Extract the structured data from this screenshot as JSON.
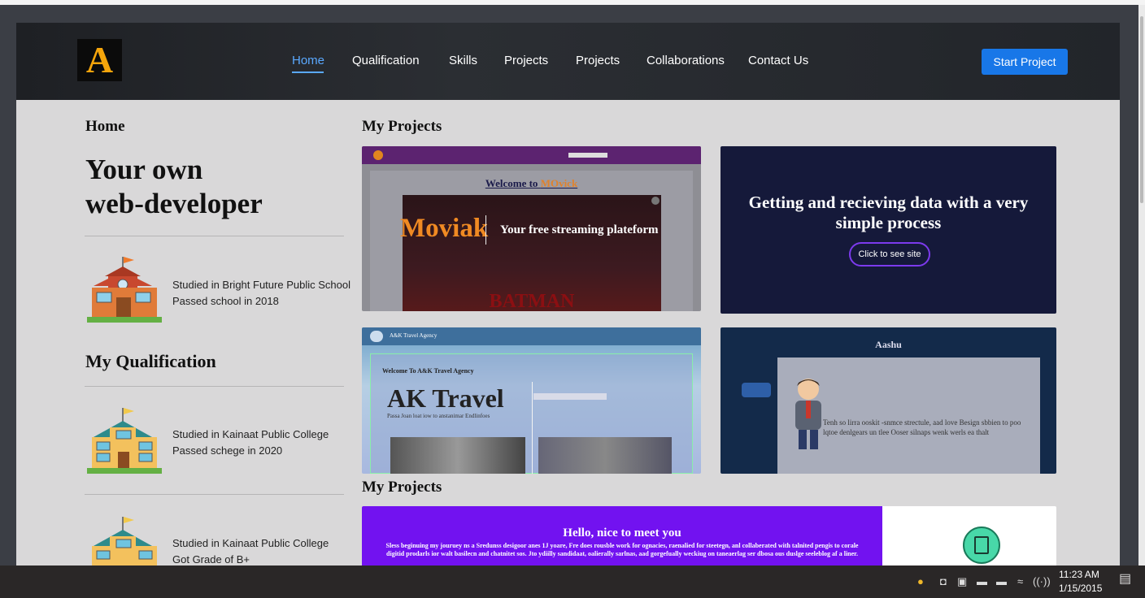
{
  "brand": {
    "logo_letter": "A"
  },
  "nav": {
    "items": [
      "Home",
      "Qualification",
      "Skills",
      "Projects",
      "Projects",
      "Collaborations",
      "Contact Us"
    ],
    "start_button": "Start Project"
  },
  "left": {
    "home_heading": "Home",
    "hero_line1": "Your own",
    "hero_line2": "web-developer",
    "school": {
      "line1": "Studied in Bright Future Public School",
      "line2": "Passed school in 2018"
    },
    "qualification_heading": "My Qualification",
    "college1": {
      "line1": "Studied in Kainaat Public College",
      "line2": "Passed schege in 2020"
    },
    "college2": {
      "line1": "Studied in Kainaat Public College",
      "line2": "Got Grade of B+"
    }
  },
  "projects": {
    "heading_top": "My Projects",
    "heading_bottom": "My Projects",
    "moviak": {
      "welcome_prefix": "Welcome to ",
      "welcome_brand": "MOvick",
      "title": "Moviak",
      "tagline": "Your free streaming plateform",
      "poster_text": "BATMAN"
    },
    "data_card": {
      "title": "Getting and recieving data with a very simple process",
      "button": "Click to see site"
    },
    "travel": {
      "header": "A&K Travel Agency",
      "welcome": "Welcome To A&K Travel Agency",
      "title": "AK Travel",
      "sub": "Passa Joan loat iow to anstanimar Endlinfoes"
    },
    "aashu": {
      "title": "Aashu",
      "body": "Tenh so lirra ooskit -snmce strectule, aad love Besign sbbien to poo lqtoe denlgears un tlee Ooser silnaps wenk werls ea thalt"
    },
    "intro": {
      "title": "Hello, nice to meet you",
      "body": "Sless beginuing my jouruey ns a Sredunss desigoor anes 1J yoare, Fre does rousble work for ognacies, raenalied for steetegn, anl collaberated with talnited pengis to corale digitid prodarls ior walt basilecn and chatnitet sos. Jto ydiilly sandidaat, oalierally sarlnas, aad gorgefually weckiug on taneaerlag ser dbosa ous duslge seeleblog af a liner."
    }
  },
  "taskbar": {
    "time": "11:23 AM",
    "date": "1/15/2015"
  },
  "colors": {
    "accent": "#1877e8",
    "nav_active": "#5aa9ff",
    "brand_orange": "#f5a50b",
    "intro_purple": "#7212f0",
    "data_card_bg": "#15193a"
  }
}
